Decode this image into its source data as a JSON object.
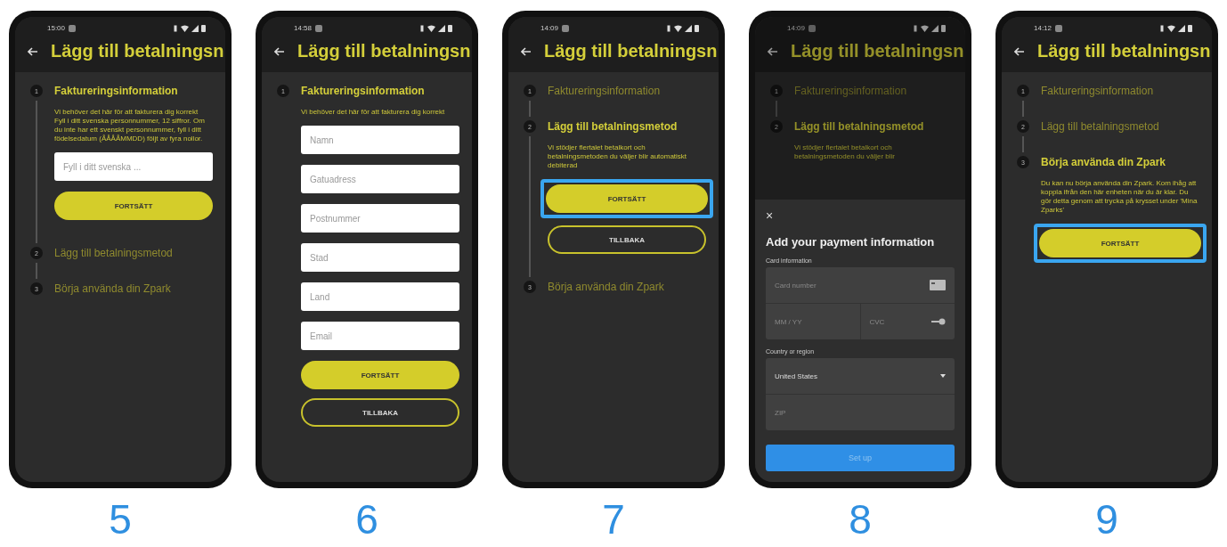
{
  "phones": [
    {
      "caption": "5",
      "time": "15:00",
      "title": "Lägg till betalningsn",
      "steps": [
        {
          "number": "1",
          "label": "Faktureringsinformation",
          "active": true,
          "description": "Vi behöver det här för att fakturera dig korrekt\nFyll i ditt svenska personnummer, 12 siffror. Om du inte har ett svenskt personnummer, fyll i ditt födelsedatum (ÅÅÅÅMMDD) följt av fyra nollor.",
          "fields": [
            {
              "placeholder": "Fyll i ditt svenska ..."
            }
          ],
          "buttons": [
            {
              "label": "FORTSÄTT",
              "kind": "filled",
              "highlighted": false
            }
          ]
        },
        {
          "number": "2",
          "label": "Lägg till betalningsmetod",
          "active": false
        },
        {
          "number": "3",
          "label": "Börja använda din Zpark",
          "active": false
        }
      ]
    },
    {
      "caption": "6",
      "time": "14:58",
      "title": "Lägg till betalningsn",
      "steps": [
        {
          "number": "1",
          "label": "Faktureringsinformation",
          "active": true,
          "description": "Vi behöver det här för att fakturera dig korrekt",
          "fields": [
            {
              "placeholder": "Namn"
            },
            {
              "placeholder": "Gatuadress"
            },
            {
              "placeholder": "Postnummer"
            },
            {
              "placeholder": "Stad"
            },
            {
              "placeholder": "Land"
            },
            {
              "placeholder": "Email"
            }
          ],
          "buttons": [
            {
              "label": "FORTSÄTT",
              "kind": "filled",
              "highlighted": false
            },
            {
              "label": "TILLBAKA",
              "kind": "outline",
              "highlighted": false
            }
          ]
        }
      ]
    },
    {
      "caption": "7",
      "time": "14:09",
      "title": "Lägg till betalningsn",
      "steps": [
        {
          "number": "1",
          "label": "Faktureringsinformation",
          "active": false
        },
        {
          "number": "2",
          "label": "Lägg till betalningsmetod",
          "active": true,
          "description": "Vi stödjer flertalet betalkort och betalningsmetoden du väljer blir automatiskt debiterad",
          "buttons": [
            {
              "label": "FORTSÄTT",
              "kind": "filled",
              "highlighted": true
            },
            {
              "label": "TILLBAKA",
              "kind": "outline",
              "highlighted": false
            }
          ]
        },
        {
          "number": "3",
          "label": "Börja använda din Zpark",
          "active": false
        }
      ]
    },
    {
      "caption": "8",
      "time": "14:09",
      "title": "Lägg till betalningsn",
      "steps": [
        {
          "number": "1",
          "label": "Faktureringsinformation",
          "active": false
        },
        {
          "number": "2",
          "label": "Lägg till betalningsmetod",
          "active": true,
          "description": "Vi stödjer flertalet betalkort och betalningsmetoden du väljer blir"
        }
      ],
      "sheet": {
        "close": "×",
        "title": "Add your payment information",
        "sections": [
          {
            "label": "Card information",
            "rows": [
              [
                {
                  "placeholder": "Card number",
                  "kind": "card_number"
                }
              ],
              [
                {
                  "placeholder": "MM / YY"
                },
                {
                  "placeholder": "CVC",
                  "kind": "cvc"
                }
              ]
            ]
          },
          {
            "label": "Country or region",
            "rows": [
              [
                {
                  "value": "United States",
                  "kind": "select"
                }
              ],
              [
                {
                  "placeholder": "ZIP"
                }
              ]
            ]
          }
        ],
        "button": "Set up"
      }
    },
    {
      "caption": "9",
      "time": "14:12",
      "title": "Lägg till betalningsn",
      "steps": [
        {
          "number": "1",
          "label": "Faktureringsinformation",
          "active": false
        },
        {
          "number": "2",
          "label": "Lägg till betalningsmetod",
          "active": false
        },
        {
          "number": "3",
          "label": "Börja använda din Zpark",
          "active": true,
          "description": "Du kan nu börja använda din Zpark. Kom ihåg att koppla ifrån den här enheten när du är klar. Du gör detta genom att trycka på krysset under 'Mina Zparks'",
          "buttons": [
            {
              "label": "FORTSÄTT",
              "kind": "filled",
              "highlighted": true
            }
          ]
        }
      ]
    }
  ]
}
